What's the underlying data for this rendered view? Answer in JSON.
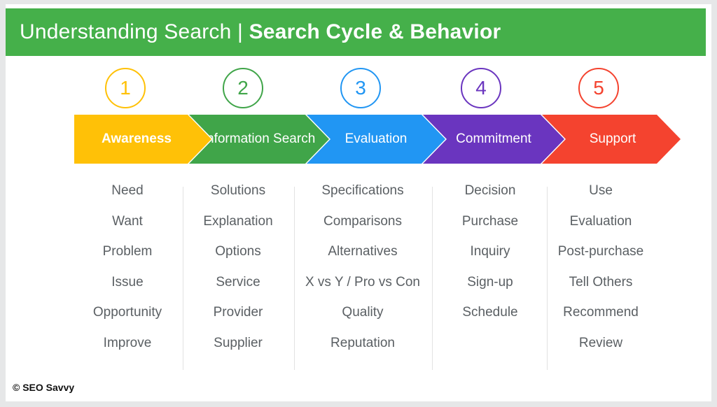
{
  "header": {
    "title_regular": "Understanding Search | ",
    "title_bold": "Search Cycle & Behavior",
    "background_color": "#45b04a",
    "text_color": "#ffffff"
  },
  "stages": [
    {
      "number": "1",
      "label": "Awareness",
      "color": "#ffc107",
      "bold": true,
      "items": [
        "Need",
        "Want",
        "Problem",
        "Issue",
        "Opportunity",
        "Improve"
      ]
    },
    {
      "number": "2",
      "label": "Information Search",
      "color": "#40a549",
      "bold": false,
      "items": [
        "Solutions",
        "Explanation",
        "Options",
        "Service",
        "Provider",
        "Supplier"
      ]
    },
    {
      "number": "3",
      "label": "Evaluation",
      "color": "#2196f3",
      "bold": false,
      "items": [
        "Specifications",
        "Comparisons",
        "Alternatives",
        "X vs Y / Pro vs Con",
        "Quality",
        "Reputation"
      ]
    },
    {
      "number": "4",
      "label": "Commitment",
      "color": "#6a35bf",
      "bold": false,
      "items": [
        "Decision",
        "Purchase",
        "Inquiry",
        "Sign-up",
        "Schedule"
      ]
    },
    {
      "number": "5",
      "label": "Support",
      "color": "#f4432f",
      "bold": false,
      "items": [
        "Use",
        "Evaluation",
        "Post-purchase",
        "Tell Others",
        "Recommend",
        "Review"
      ]
    }
  ],
  "footer": {
    "credit": "© SEO Savvy"
  }
}
